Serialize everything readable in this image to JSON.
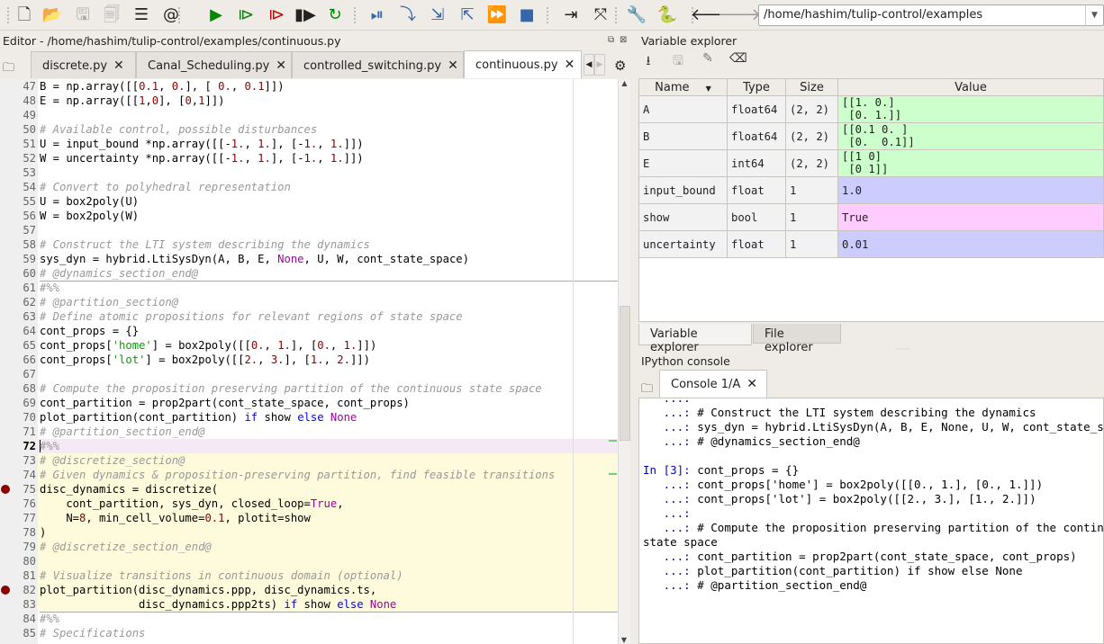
{
  "toolbar": {
    "icons": [
      "new-file-icon",
      "open-file-icon",
      "save-icon",
      "save-all-icon",
      "outline-icon",
      "at-icon",
      "run-icon",
      "run-cell-icon",
      "run-cell-advance-icon",
      "run-selection-icon",
      "rerun-icon",
      "debug-icon",
      "step-icon",
      "step-into-icon",
      "step-return-icon",
      "continue-icon",
      "stop-icon",
      "maximize-pane-icon",
      "fullscreen-icon",
      "preferences-icon",
      "python-path-icon",
      "back-icon",
      "forward-icon"
    ],
    "path": "/home/hashim/tulip-control/examples"
  },
  "editor": {
    "title": "Editor - /home/hashim/tulip-control/examples/continuous.py",
    "tabs": [
      "discrete.py",
      "Canal_Scheduling.py",
      "controlled_switching.py",
      "continuous.py"
    ],
    "active_tab": 3,
    "current_line": 72,
    "breakpoints": [
      75,
      82
    ],
    "lines": [
      [
        47,
        [
          "B = np.array([[",
          [
            "n",
            "0.1"
          ],
          ", ",
          [
            "n",
            "0."
          ],
          "], [ ",
          [
            "n",
            "0."
          ],
          ", ",
          [
            "n",
            "0.1"
          ],
          "]])"
        ]
      ],
      [
        48,
        [
          "E = np.array([[",
          [
            "n",
            "1"
          ],
          ",",
          [
            "n",
            "0"
          ],
          "], [",
          [
            "n",
            "0"
          ],
          ",",
          [
            "n",
            "1"
          ],
          "]])"
        ]
      ],
      [
        49,
        []
      ],
      [
        50,
        [
          [
            "c",
            "# Available control, possible disturbances"
          ]
        ]
      ],
      [
        51,
        [
          "U = input_bound *np.array([[-",
          [
            "n",
            "1."
          ],
          ", ",
          [
            "n",
            "1."
          ],
          "], [-",
          [
            "n",
            "1."
          ],
          ", ",
          [
            "n",
            "1."
          ],
          "]])"
        ]
      ],
      [
        52,
        [
          "W = uncertainty *np.array([[-",
          [
            "n",
            "1."
          ],
          ", ",
          [
            "n",
            "1."
          ],
          "], [-",
          [
            "n",
            "1."
          ],
          ", ",
          [
            "n",
            "1."
          ],
          "]])"
        ]
      ],
      [
        53,
        []
      ],
      [
        54,
        [
          [
            "c",
            "# Convert to polyhedral representation"
          ]
        ]
      ],
      [
        55,
        [
          "U = box2poly(U)"
        ]
      ],
      [
        56,
        [
          "W = box2poly(W)"
        ]
      ],
      [
        57,
        []
      ],
      [
        58,
        [
          [
            "c",
            "# Construct the LTI system describing the dynamics"
          ]
        ]
      ],
      [
        59,
        [
          "sys_dyn = hybrid.LtiSysDyn(A, B, E, ",
          [
            "p",
            "None"
          ],
          ", U, W, cont_state_space)"
        ]
      ],
      [
        60,
        [
          [
            "c",
            "# @dynamics_section_end@"
          ]
        ]
      ],
      [
        61,
        [
          [
            "c",
            "#%%"
          ]
        ]
      ],
      [
        62,
        [
          [
            "c",
            "# @partition_section@"
          ]
        ]
      ],
      [
        63,
        [
          [
            "c",
            "# Define atomic propositions for relevant regions of state space"
          ]
        ]
      ],
      [
        64,
        [
          "cont_props = {}"
        ]
      ],
      [
        65,
        [
          "cont_props[",
          [
            "s",
            "'home'"
          ],
          "] = box2poly([[",
          [
            "n",
            "0."
          ],
          ", ",
          [
            "n",
            "1."
          ],
          "], [",
          [
            "n",
            "0."
          ],
          ", ",
          [
            "n",
            "1."
          ],
          "]])"
        ]
      ],
      [
        66,
        [
          "cont_props[",
          [
            "s",
            "'lot'"
          ],
          "] = box2poly([[",
          [
            "n",
            "2."
          ],
          ", ",
          [
            "n",
            "3."
          ],
          "], [",
          [
            "n",
            "1."
          ],
          ", ",
          [
            "n",
            "2."
          ],
          "]])"
        ]
      ],
      [
        67,
        []
      ],
      [
        68,
        [
          [
            "c",
            "# Compute the proposition preserving partition of the continuous state space"
          ]
        ]
      ],
      [
        69,
        [
          "cont_partition = prop2part(cont_state_space, cont_props)"
        ]
      ],
      [
        70,
        [
          "plot_partition(cont_partition) ",
          [
            "k",
            "if"
          ],
          " show ",
          [
            "k",
            "else"
          ],
          " ",
          [
            "p",
            "None"
          ]
        ]
      ],
      [
        71,
        [
          [
            "c",
            "# @partition_section_end@"
          ]
        ]
      ],
      [
        72,
        [
          [
            "c",
            "#%%"
          ]
        ]
      ],
      [
        73,
        [
          [
            "c",
            "# @discretize_section@"
          ]
        ]
      ],
      [
        74,
        [
          [
            "c",
            "# Given dynamics & proposition-preserving partition, find feasible transitions"
          ]
        ]
      ],
      [
        75,
        [
          "disc_dynamics = discretize("
        ]
      ],
      [
        76,
        [
          "    cont_partition, sys_dyn, closed_loop=",
          [
            "p",
            "True"
          ],
          ","
        ]
      ],
      [
        77,
        [
          "    N=",
          [
            "n",
            "8"
          ],
          ", min_cell_volume=",
          [
            "n",
            "0.1"
          ],
          ", plotit=show"
        ]
      ],
      [
        78,
        [
          ")"
        ]
      ],
      [
        79,
        [
          [
            "c",
            "# @discretize_section_end@"
          ]
        ]
      ],
      [
        80,
        []
      ],
      [
        81,
        [
          [
            "c",
            "# Visualize transitions in continuous domain (optional)"
          ]
        ]
      ],
      [
        82,
        [
          "plot_partition(disc_dynamics.ppp, disc_dynamics.ts,"
        ]
      ],
      [
        83,
        [
          "               disc_dynamics.ppp2ts) ",
          [
            "k",
            "if"
          ],
          " show ",
          [
            "k",
            "else"
          ],
          " ",
          [
            "p",
            "None"
          ]
        ]
      ],
      [
        84,
        [
          [
            "c",
            "#%%"
          ]
        ]
      ],
      [
        85,
        [
          [
            "c",
            "# Specifications"
          ]
        ]
      ]
    ]
  },
  "variable_explorer": {
    "title": "Variable explorer",
    "columns": [
      "Name",
      "Type",
      "Size",
      "Value"
    ],
    "rows": [
      {
        "name": "A",
        "type": "float64",
        "size": "(2, 2)",
        "value": "[[1. 0.]\n [0. 1.]]",
        "color": "#ccffcc"
      },
      {
        "name": "B",
        "type": "float64",
        "size": "(2, 2)",
        "value": "[[0.1 0. ]\n [0.  0.1]]",
        "color": "#ccffcc"
      },
      {
        "name": "E",
        "type": "int64",
        "size": "(2, 2)",
        "value": "[[1 0]\n [0 1]]",
        "color": "#ccffcc"
      },
      {
        "name": "input_bound",
        "type": "float",
        "size": "1",
        "value": "1.0",
        "color": "#ccccff"
      },
      {
        "name": "show",
        "type": "bool",
        "size": "1",
        "value": "True",
        "color": "#ffccff"
      },
      {
        "name": "uncertainty",
        "type": "float",
        "size": "1",
        "value": "0.01",
        "color": "#ccccff"
      }
    ],
    "bottom_tabs": [
      "Variable explorer",
      "File explorer"
    ]
  },
  "console": {
    "title": "IPython console",
    "tab": "Console 1/A",
    "lines": [
      [
        "   ...:",
        []
      ],
      [
        "   ...:",
        [
          " ",
          [
            "ci",
            "# Construct the LTI system describing the dynamics"
          ]
        ]
      ],
      [
        "   ...:",
        [
          " sys_dyn = hybrid.LtiSysDyn(A, B, E, ",
          [
            "cN",
            "None"
          ],
          ", U, W, cont_state_space)"
        ]
      ],
      [
        "   ...:",
        [
          " ",
          [
            "ci",
            "# @dynamics_section_end@"
          ]
        ]
      ],
      [
        "",
        []
      ],
      [
        "In [3]:",
        [
          " cont_props = {}"
        ]
      ],
      [
        "   ...:",
        [
          " cont_props[",
          [
            "cs",
            "'home'"
          ],
          "] = box2poly([[",
          [
            "cn",
            "0."
          ],
          ", ",
          [
            "cn",
            "1."
          ],
          "], [",
          [
            "cn",
            "0."
          ],
          ", ",
          [
            "cn",
            "1."
          ],
          "]])"
        ]
      ],
      [
        "   ...:",
        [
          " cont_props[",
          [
            "cs",
            "'lot'"
          ],
          "] = box2poly([[",
          [
            "cn",
            "2."
          ],
          ", ",
          [
            "cn",
            "3."
          ],
          "], [",
          [
            "cn",
            "1."
          ],
          ", ",
          [
            "cn",
            "2."
          ],
          "]])"
        ]
      ],
      [
        "   ...:",
        []
      ],
      [
        "   ...:",
        [
          " ",
          [
            "ci",
            "# Compute the proposition preserving partition of the continuous"
          ]
        ]
      ],
      [
        "",
        [
          [
            "ci",
            "state space"
          ]
        ]
      ],
      [
        "   ...:",
        [
          " cont_partition = prop2part(cont_state_space, cont_props)"
        ]
      ],
      [
        "   ...:",
        [
          " plot_partition(cont_partition) ",
          [
            "ck",
            "if"
          ],
          " show ",
          [
            "ck",
            "else"
          ],
          " ",
          [
            "cN",
            "None"
          ]
        ]
      ],
      [
        "   ...:",
        [
          " ",
          [
            "ci",
            "# @partition_section_end@"
          ]
        ]
      ]
    ]
  }
}
